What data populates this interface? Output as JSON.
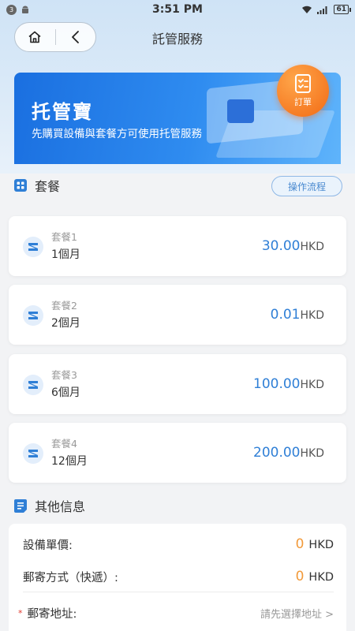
{
  "status_bar": {
    "notification_count": "3",
    "time": "3:51 PM",
    "battery": "61"
  },
  "nav": {
    "title": "託管服務"
  },
  "banner": {
    "title": "托管寶",
    "subtitle": "先購買設備與套餐方可使用托管服務",
    "order_label": "訂單"
  },
  "packages_section": {
    "title": "套餐",
    "flow_button": "操作流程",
    "items": [
      {
        "name": "套餐1",
        "duration": "1個月",
        "amount": "30.00",
        "unit": "HKD"
      },
      {
        "name": "套餐2",
        "duration": "2個月",
        "amount": "0.01",
        "unit": "HKD"
      },
      {
        "name": "套餐3",
        "duration": "6個月",
        "amount": "100.00",
        "unit": "HKD"
      },
      {
        "name": "套餐4",
        "duration": "12個月",
        "amount": "200.00",
        "unit": "HKD"
      }
    ]
  },
  "other_section": {
    "title": "其他信息",
    "device_price_label": "設備單價:",
    "device_price_value": "0",
    "device_price_unit": "HKD",
    "shipping_label": "郵寄方式（快遞）:",
    "shipping_value": "0",
    "shipping_unit": "HKD",
    "address_required_mark": "*",
    "address_label": "郵寄地址:",
    "address_hint": "請先選擇地址 >"
  },
  "colors": {
    "accent_blue": "#2f7fd6",
    "price_orange": "#f29a3a",
    "badge_orange": "#f26a14"
  }
}
